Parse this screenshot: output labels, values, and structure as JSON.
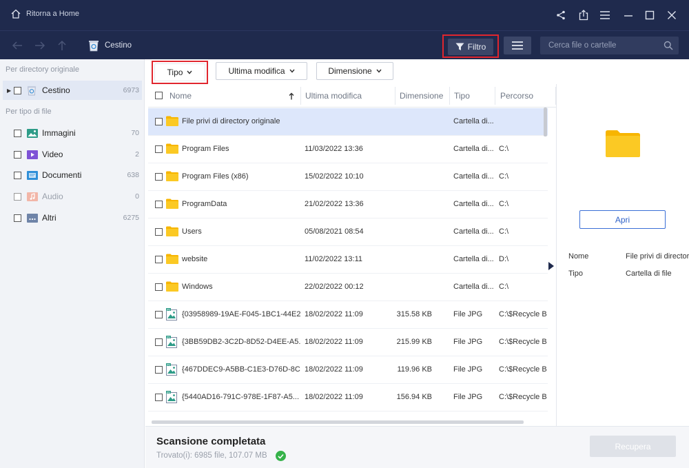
{
  "titlebar": {
    "home_label": "Ritorna a Home",
    "icons": [
      "home-icon",
      "share-icon",
      "export-icon",
      "menu-icon",
      "minimize-icon",
      "maximize-icon",
      "close-icon"
    ]
  },
  "toolbar": {
    "breadcrumb": "Cestino",
    "filter_label": "Filtro",
    "search_placeholder": "Cerca file o cartelle"
  },
  "sidebar": {
    "section_original": "Per directory originale",
    "original_items": [
      {
        "label": "Cestino",
        "count": "6973"
      }
    ],
    "section_type": "Per tipo di file",
    "type_items": [
      {
        "label": "Immagini",
        "count": "70",
        "icon": "image-folder-icon"
      },
      {
        "label": "Video",
        "count": "2",
        "icon": "video-folder-icon"
      },
      {
        "label": "Documenti",
        "count": "638",
        "icon": "document-folder-icon"
      },
      {
        "label": "Audio",
        "count": "0",
        "icon": "audio-folder-icon"
      },
      {
        "label": "Altri",
        "count": "6275",
        "icon": "other-folder-icon"
      }
    ]
  },
  "filters": {
    "tipo": "Tipo",
    "ultima_modifica": "Ultima modifica",
    "dimensione": "Dimensione"
  },
  "table": {
    "columns": [
      "Nome",
      "Ultima modifica",
      "Dimensione",
      "Tipo",
      "Percorso"
    ],
    "rows": [
      {
        "name": "File privi di directory originale",
        "modified": "",
        "size": "",
        "type": "Cartella di...",
        "path": "",
        "kind": "folder",
        "selected": true
      },
      {
        "name": "Program Files",
        "modified": "11/03/2022 13:36",
        "size": "",
        "type": "Cartella di...",
        "path": "C:\\",
        "kind": "folder"
      },
      {
        "name": "Program Files (x86)",
        "modified": "15/02/2022 10:10",
        "size": "",
        "type": "Cartella di...",
        "path": "C:\\",
        "kind": "folder"
      },
      {
        "name": "ProgramData",
        "modified": "21/02/2022 13:36",
        "size": "",
        "type": "Cartella di...",
        "path": "C:\\",
        "kind": "folder"
      },
      {
        "name": "Users",
        "modified": "05/08/2021 08:54",
        "size": "",
        "type": "Cartella di...",
        "path": "C:\\",
        "kind": "folder"
      },
      {
        "name": "website",
        "modified": "11/02/2022 13:11",
        "size": "",
        "type": "Cartella di...",
        "path": "D:\\",
        "kind": "folder"
      },
      {
        "name": "Windows",
        "modified": "22/02/2022 00:12",
        "size": "",
        "type": "Cartella di...",
        "path": "C:\\",
        "kind": "folder"
      },
      {
        "name": "{03958989-19AE-F045-1BC1-44E2...",
        "modified": "18/02/2022 11:09",
        "size": "315.58 KB",
        "type": "File JPG",
        "path": "C:\\$Recycle Bin",
        "kind": "image"
      },
      {
        "name": "{3BB59DB2-3C2D-8D52-D4EE-A5...",
        "modified": "18/02/2022 11:09",
        "size": "215.99 KB",
        "type": "File JPG",
        "path": "C:\\$Recycle Bin",
        "kind": "image"
      },
      {
        "name": "{467DDEC9-A5BB-C1E3-D76D-8C...",
        "modified": "18/02/2022 11:09",
        "size": "119.96 KB",
        "type": "File JPG",
        "path": "C:\\$Recycle Bin",
        "kind": "image"
      },
      {
        "name": "{5440AD16-791C-978E-1F87-A5...",
        "modified": "18/02/2022 11:09",
        "size": "156.94 KB",
        "type": "File JPG",
        "path": "C:\\$Recycle Bin",
        "kind": "image"
      }
    ]
  },
  "details": {
    "open_label": "Apri",
    "name_label": "Nome",
    "name_value": "File privi di directory originale",
    "type_label": "Tipo",
    "type_value": "Cartella di file"
  },
  "footer": {
    "status_title": "Scansione completata",
    "status_sub": "Trovato(i): 6985 file, 107.07 MB",
    "recover_label": "Recupera"
  },
  "colors": {
    "header_bg": "#1f2a4d",
    "highlight_red": "#e0262e",
    "accent_blue": "#2f62c8",
    "folder_yellow": "#f7c21a",
    "success_green": "#36b24a"
  }
}
